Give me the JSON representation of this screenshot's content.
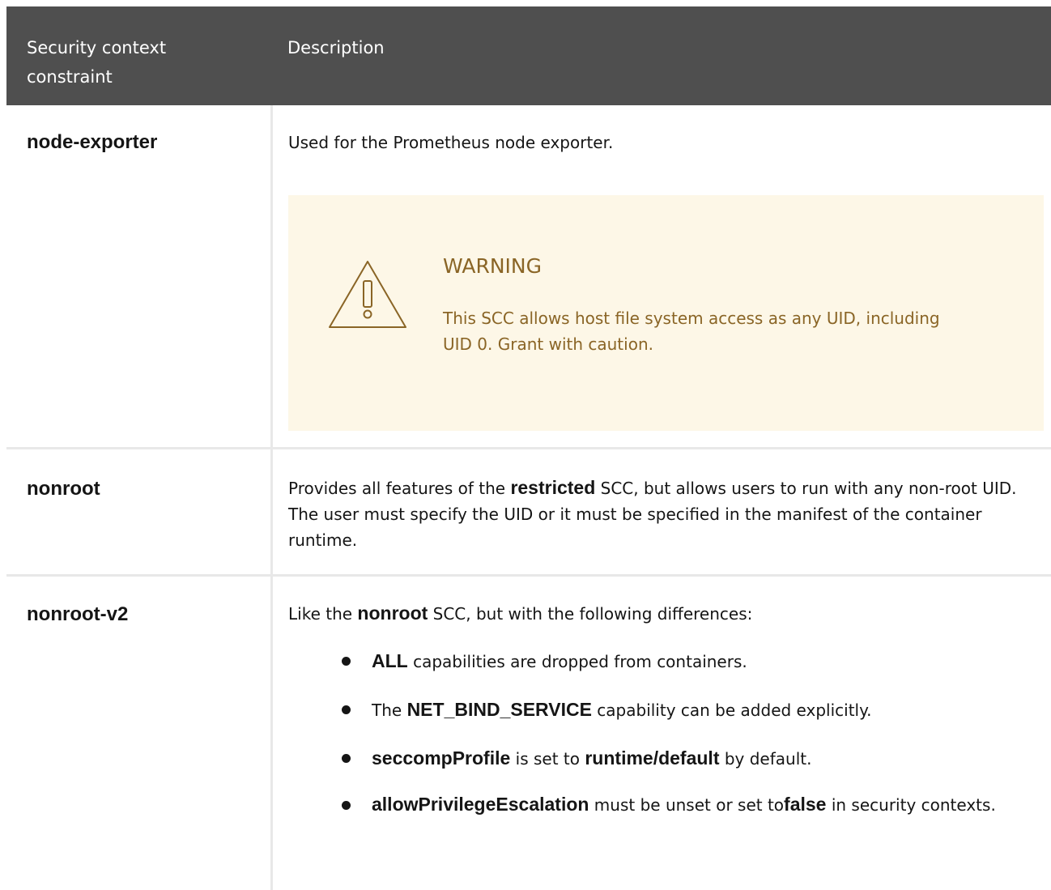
{
  "header": {
    "col1": "Security context constraint",
    "col2": "Description"
  },
  "rows": [
    {
      "name": "node-exporter",
      "description": "Used for the Prometheus node exporter.",
      "warning": {
        "icon": "warning-triangle-icon",
        "title": "WARNING",
        "text": "This SCC allows host file system access as any UID, including UID 0. Grant with caution."
      }
    },
    {
      "name": "nonroot",
      "desc_pre": "Provides all features of the ",
      "desc_bold": "restricted",
      "desc_post": " SCC, but allows users to run with any non-root UID. The user must specify the UID or it must be specified in the manifest of the container runtime."
    },
    {
      "name": "nonroot-v2",
      "desc_pre": "Like the ",
      "desc_bold": "nonroot",
      "desc_post": " SCC, but with the following differences:",
      "items": [
        {
          "b1": "ALL",
          "t1": " capabilities are dropped from containers."
        },
        {
          "t0": "The ",
          "b1": "NET_BIND_SERVICE",
          "t1": " capability can be added explicitly."
        },
        {
          "b1": "seccompProfile",
          "t1": " is set to ",
          "b2": "runtime/default",
          "t2": " by default."
        },
        {
          "b1": "allowPrivilegeEscalation",
          "t1": " must be unset or set to",
          "b2": "false",
          "t2": " in security contexts."
        }
      ]
    }
  ],
  "colors": {
    "header_bg": "#4f4f4f",
    "warning_bg": "#fdf7e7",
    "warning_text": "#8a6526",
    "divider": "#e8e8e8"
  }
}
